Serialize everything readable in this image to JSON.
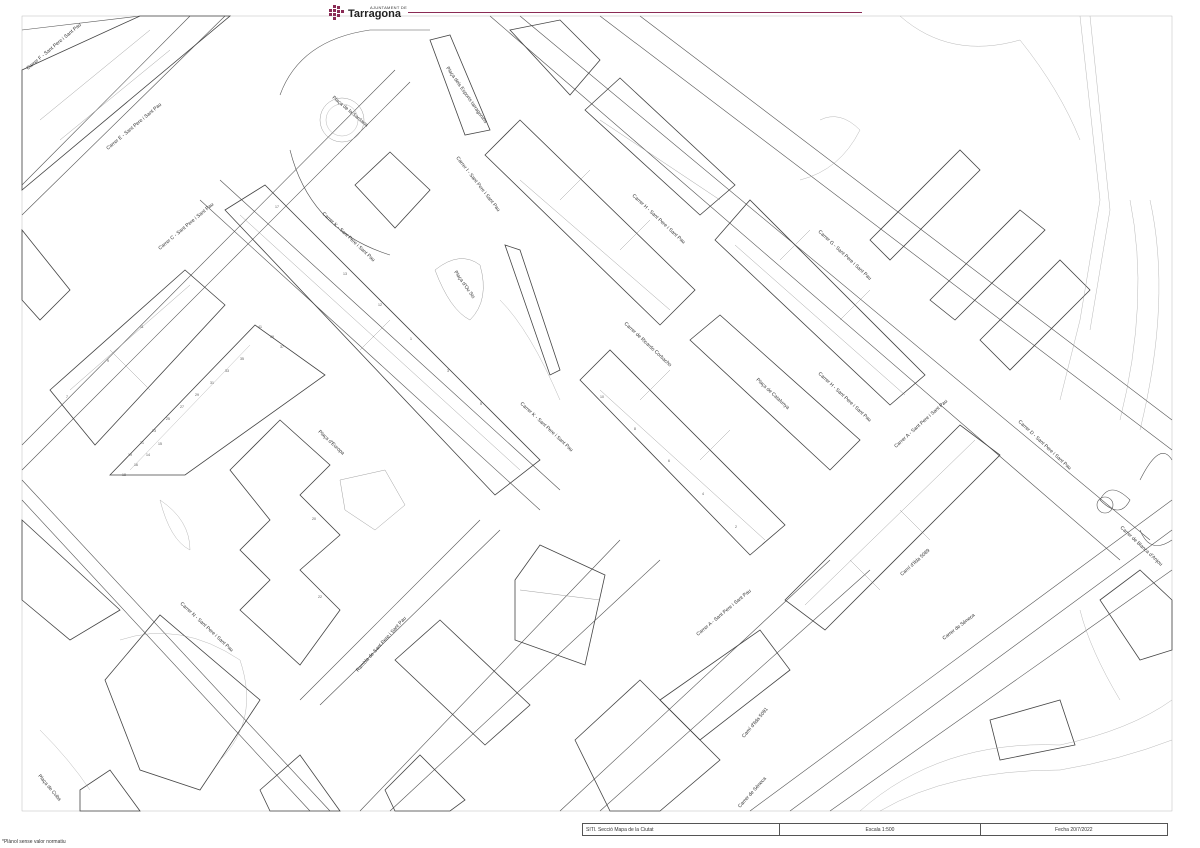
{
  "header": {
    "logo_small": "AJUNTAMENT DE",
    "logo_big": "Tarragona",
    "brand_color": "#8a2b55"
  },
  "streets": {
    "carrer_f": "Carrer F - Sant Pere i Sant Pau",
    "carrer_e": "Carrer E - Sant Pere i Sant Pau",
    "carrer_c": "Carrer C - Sant Pere i Sant Pau",
    "placa_sardana": "Plaça de la Sardana",
    "placa_esports": "Plaça dels Esports tarragonins",
    "carrer_i": "Carrer I - Sant Pere i Sant Pau",
    "carrer_h_top": "Carrer H - Sant Pere i Sant Pau",
    "carrer_g": "Carrer G - Sant Pere i Sant Pau",
    "carrer_k_top": "Carrer K - Sant Pere i Sant Pau",
    "placa_ou": "Plaça d'Ou Sis",
    "carrer_ricardo": "Carrer de Ricardo Corbacho",
    "placa_catalunya": "Plaça de Catalunya",
    "carrer_h_mid": "Carrer H - Sant Pere i Sant Pau",
    "carrer_d": "Carrer D - Sant Pere i Sant Pau",
    "carrer_k_mid": "Carrer K - Sant Pere i Sant Pau",
    "placa_europa": "Plaça d'Europa",
    "carrer_a_right": "Carrer A - Sant Pere i Sant Pau",
    "cami_ilda_upper": "Camí d'Ilda 5089",
    "carrer_blanca": "Carrer de Blanca d'Anjou",
    "carrer_n": "Carrer N - Sant Pere i Sant Pau",
    "rambla": "Rambla de Sant Pere i Sant Pau",
    "carrer_a_mid": "Carrer A - Sant Pere i Sant Pau",
    "carrer_seneca_right": "Carrer de Sèneca",
    "cami_ilda_lower": "Camí d'Ilda 5091",
    "carrer_seneca_bottom": "Carrer de Sèneca",
    "placa_cuba": "Plaça de Cuba"
  },
  "numbers": [
    "17",
    "13",
    "11",
    "12",
    "9",
    "7",
    "5",
    "3",
    "1",
    "41",
    "39",
    "37",
    "35",
    "33",
    "31",
    "29",
    "27",
    "25",
    "23",
    "21",
    "19",
    "10",
    "8",
    "6",
    "4",
    "2",
    "15",
    "14",
    "16",
    "18",
    "20",
    "22"
  ],
  "footer": {
    "source": "SITI. Secció Mapa de la Ciutat",
    "scale": "Escala 1:500",
    "date": "Fecha 20/7/2022"
  },
  "disclaimer": "*Plànol sense valor normatiu"
}
